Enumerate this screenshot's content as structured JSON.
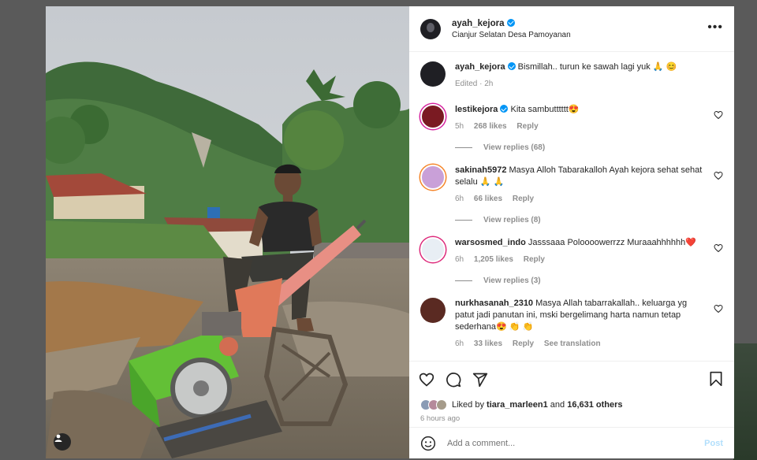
{
  "post": {
    "author": "ayah_kejora",
    "location": "Cianjur Selatan Desa Pamoyanan",
    "caption_author": "ayah_kejora",
    "caption": "Bismillah.. turun ke sawah lagi yuk 🙏 😊",
    "caption_meta": "Edited · 2h"
  },
  "comments": [
    {
      "user": "lestikejora",
      "text": "Kita sambutttttt😍",
      "time": "5h",
      "likes": "268 likes",
      "reply": "Reply",
      "replies": "View replies (68)",
      "avatar_color": "#7a1a22"
    },
    {
      "user": "sakinah5972",
      "text": "Masya Alloh Tabarakalloh Ayah kejora sehat sehat selalu 🙏 🙏",
      "time": "6h",
      "likes": "66 likes",
      "reply": "Reply",
      "replies": "View replies (8)",
      "avatar_color": "#c9a0d8"
    },
    {
      "user": "warsosmed_indo",
      "text": "Jasssaaa Poloooowerrzz Muraaahhhhhh❤️",
      "time": "6h",
      "likes": "1,205 likes",
      "reply": "Reply",
      "replies": "View replies (3)",
      "avatar_color": "#e8eef4"
    },
    {
      "user": "nurkhasanah_2310",
      "text": "Masya Allah tabarrakallah.. keluarga yg patut jadi panutan ini, mski bergelimang harta namun tetap sederhana😍 👏 👏",
      "time": "6h",
      "likes": "33 likes",
      "reply": "Reply",
      "extra": "See translation",
      "avatar_color": "#5a2a22"
    }
  ],
  "likes": {
    "prefix": "Liked by",
    "user": "tiara_marleen1",
    "and": "and",
    "others": "16,631 others"
  },
  "posted_ago": "6 hours ago",
  "add_comment": {
    "placeholder": "Add a comment...",
    "post_label": "Post"
  },
  "icons": [
    "more-options-icon",
    "heart-icon",
    "comment-icon",
    "share-icon",
    "bookmark-icon",
    "emoji-icon",
    "tag-user-icon",
    "verified-badge-icon"
  ]
}
